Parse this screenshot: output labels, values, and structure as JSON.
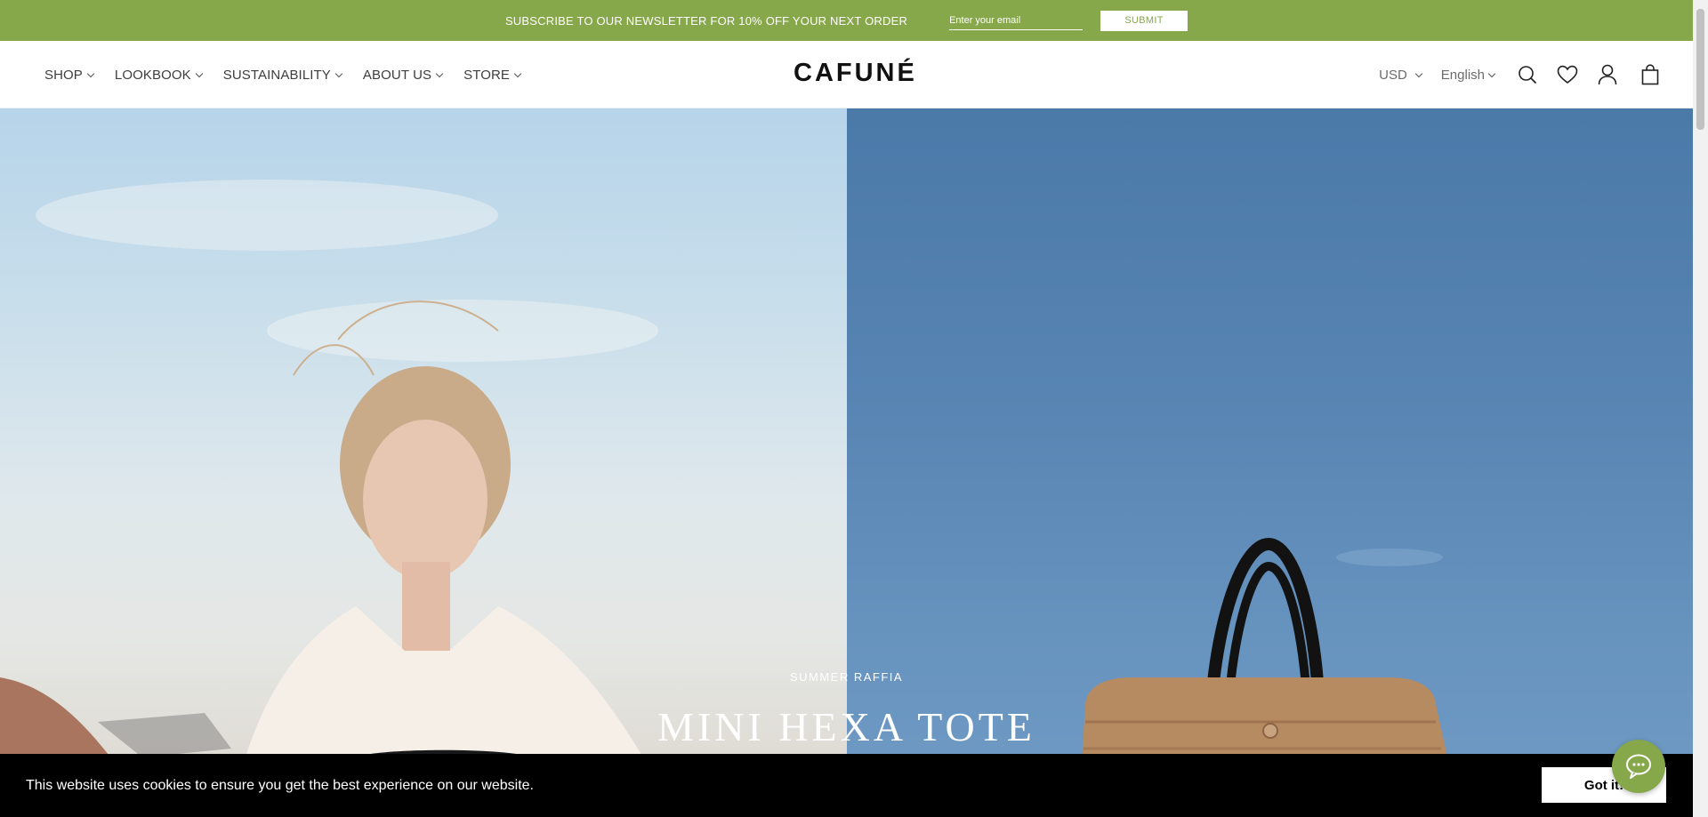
{
  "announcement": {
    "message": "SUBSCRIBE TO OUR NEWSLETTER FOR 10% OFF YOUR NEXT ORDER",
    "email_placeholder": "Enter your email",
    "submit_label": "SUBMIT",
    "background_color": "#86a74a"
  },
  "header": {
    "nav": [
      {
        "label": "SHOP"
      },
      {
        "label": "LOOKBOOK"
      },
      {
        "label": "SUSTAINABILITY"
      },
      {
        "label": "ABOUT US"
      },
      {
        "label": "STORE"
      }
    ],
    "logo": "CAFUNÉ",
    "currency": "USD",
    "language": "English",
    "icons": [
      "search-icon",
      "wishlist-heart-icon",
      "account-icon",
      "cart-bag-icon"
    ]
  },
  "hero": {
    "kicker": "SUMMER RAFFIA",
    "title": "MINI HEXA TOTE"
  },
  "cookie_banner": {
    "message": "This website uses cookies to ensure you get the best experience on our website.",
    "button_label": "Got it!"
  },
  "chat": {
    "icon": "chat-bubble-icon"
  }
}
